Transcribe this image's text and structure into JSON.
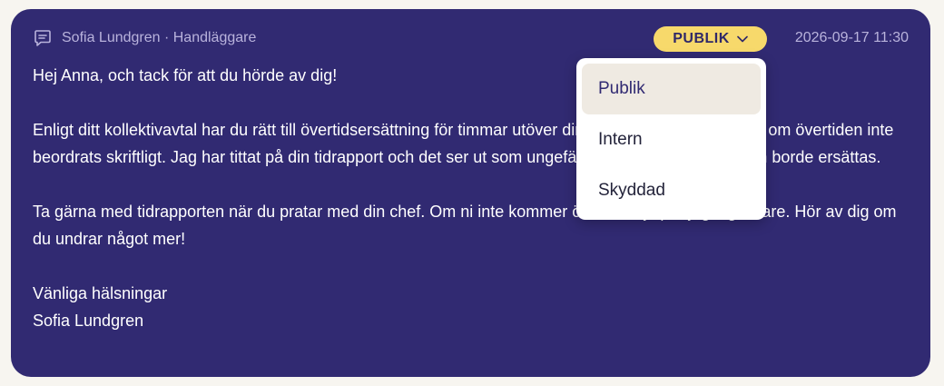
{
  "header": {
    "author": "Sofia Lundgren · Handläggare",
    "timestamp": "2026-09-17 11:30",
    "visibility_label": "PUBLIK"
  },
  "message": {
    "paragraphs": [
      "Hej Anna, och tack för att du hörde av dig!",
      "Enligt ditt kollektivavtal har du rätt till övertidsersättning för timmar utöver din ordinarie arbetstid, även om övertiden inte beordrats skriftligt. Jag har tittat på din tidrapport och det ser ut som ungefär tolv timmar i augusti som borde ersättas.",
      "Ta gärna med tidrapporten när du pratar med din chef. Om ni inte kommer överens hjälper jag dig vidare. Hör av dig om du undrar något mer!",
      "Vänliga hälsningar",
      "Sofia Lundgren"
    ]
  },
  "dropdown": {
    "options": [
      {
        "label": "Publik",
        "selected": true
      },
      {
        "label": "Intern",
        "selected": false
      },
      {
        "label": "Skyddad",
        "selected": false
      }
    ]
  },
  "colors": {
    "card_bg": "#312a72",
    "badge_bg": "#f7d96b",
    "selected_bg": "#efeae2"
  },
  "icons": {
    "author_icon": "chat-bubble-icon",
    "badge_icon": "chevron-down-icon"
  }
}
